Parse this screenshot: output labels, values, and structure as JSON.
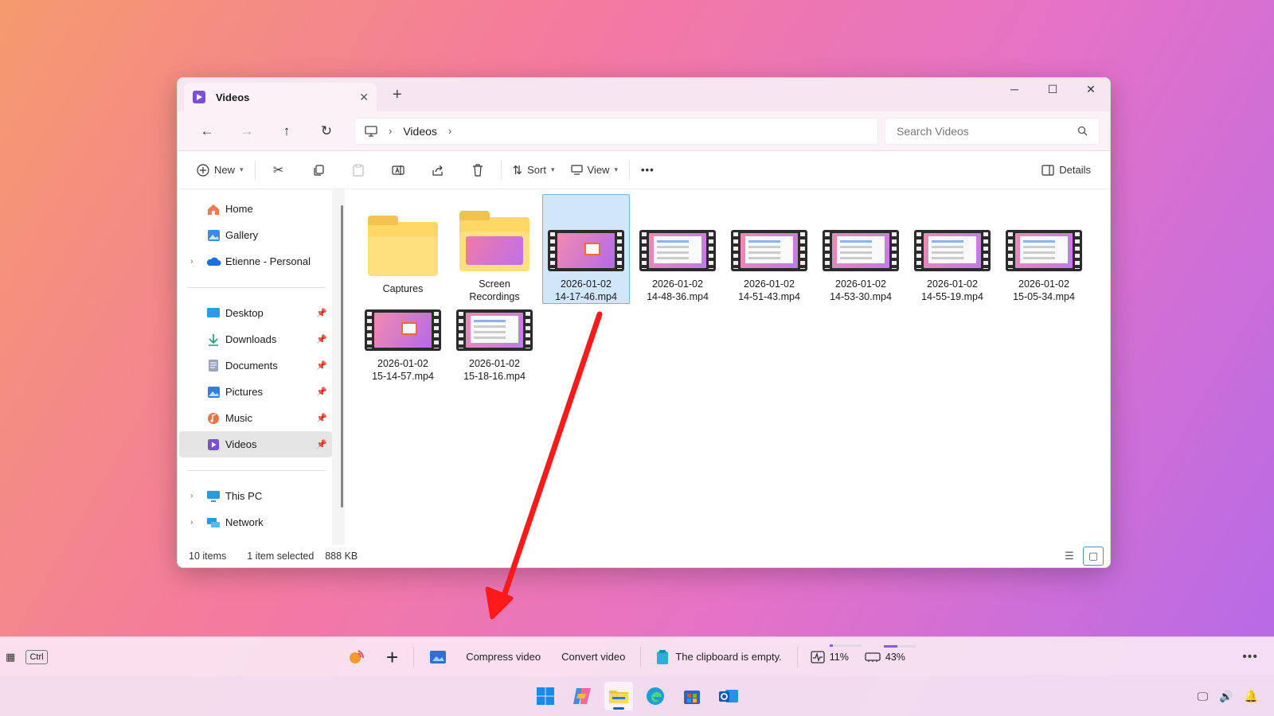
{
  "window": {
    "tab_title": "Videos",
    "tab_close": "✕",
    "new_tab": "+",
    "controls": {
      "minimize": "─",
      "maximize": "☐",
      "close": "✕"
    }
  },
  "nav": {
    "back": "←",
    "forward": "→",
    "up": "↑",
    "refresh": "↻",
    "breadcrumb": [
      "Videos"
    ],
    "search_placeholder": "Search Videos"
  },
  "toolbar": {
    "new_label": "New",
    "sort_label": "Sort",
    "view_label": "View",
    "more_label": "•••",
    "details_label": "Details"
  },
  "sidebar": {
    "top": [
      {
        "label": "Home",
        "icon": "home-icon"
      },
      {
        "label": "Gallery",
        "icon": "gallery-icon"
      },
      {
        "label": "Etienne - Personal",
        "icon": "cloud-icon",
        "expandable": true
      }
    ],
    "pinned": [
      {
        "label": "Desktop",
        "icon": "desktop-icon"
      },
      {
        "label": "Downloads",
        "icon": "download-icon"
      },
      {
        "label": "Documents",
        "icon": "documents-icon"
      },
      {
        "label": "Pictures",
        "icon": "pictures-icon"
      },
      {
        "label": "Music",
        "icon": "music-icon"
      },
      {
        "label": "Videos",
        "icon": "videos-icon",
        "selected": true
      }
    ],
    "bottom": [
      {
        "label": "This PC",
        "icon": "pc-icon",
        "expandable": true
      },
      {
        "label": "Network",
        "icon": "network-icon",
        "expandable": true
      }
    ]
  },
  "files": {
    "row1": [
      {
        "name1": "Captures",
        "name2": "",
        "type": "folder"
      },
      {
        "name1": "Screen",
        "name2": "Recordings",
        "type": "folder-img"
      },
      {
        "name1": "2026-01-02",
        "name2": "14-17-46.mp4",
        "type": "video-pink",
        "selected": true
      },
      {
        "name1": "2026-01-02",
        "name2": "14-48-36.mp4",
        "type": "video-doc"
      },
      {
        "name1": "2026-01-02",
        "name2": "14-51-43.mp4",
        "type": "video-doc"
      },
      {
        "name1": "2026-01-02",
        "name2": "14-53-30.mp4",
        "type": "video-doc"
      },
      {
        "name1": "2026-01-02",
        "name2": "14-55-19.mp4",
        "type": "video-doc"
      },
      {
        "name1": "2026-01-02",
        "name2": "15-05-34.mp4",
        "type": "video-doc"
      }
    ],
    "row2": [
      {
        "name1": "2026-01-02",
        "name2": "15-14-57.mp4",
        "type": "video-pink"
      },
      {
        "name1": "2026-01-02",
        "name2": "15-18-16.mp4",
        "type": "video-doc"
      }
    ]
  },
  "status": {
    "items": "10 items",
    "selection": "1 item selected",
    "size": "888 KB"
  },
  "companion": {
    "ctrl_key": "Ctrl",
    "add": "+",
    "compress": "Compress video",
    "convert": "Convert video",
    "clipboard": "The clipboard is empty.",
    "cpu": "11%",
    "cpu_level": 0.11,
    "memory": "43%",
    "memory_level": 0.43,
    "more": "•••"
  },
  "colors": {
    "accent": "#0067c0",
    "selection": "#cfe6fb",
    "arrow": "#ff1a1a"
  }
}
